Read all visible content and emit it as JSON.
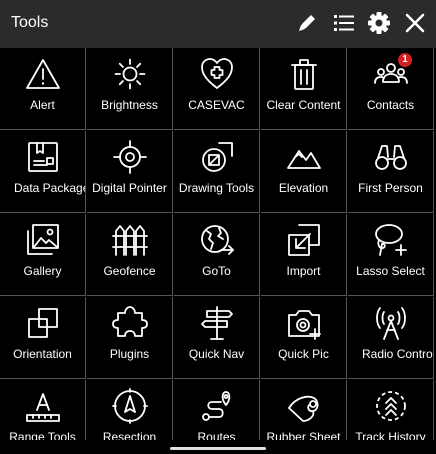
{
  "header": {
    "title": "Tools"
  },
  "header_icons": [
    "pencil-icon",
    "list-icon",
    "gear-icon",
    "close-icon"
  ],
  "accent": {
    "badge": "#d32020"
  },
  "tools": [
    {
      "label": "Alert",
      "icon": "alert-icon"
    },
    {
      "label": "Brightness",
      "icon": "brightness-icon"
    },
    {
      "label": "CASEVAC",
      "icon": "casevac-icon"
    },
    {
      "label": "Clear Content",
      "icon": "trash-icon"
    },
    {
      "label": "Contacts",
      "icon": "contacts-icon",
      "badge": "1"
    },
    {
      "label": "Data Packages",
      "icon": "data-packages-icon"
    },
    {
      "label": "Digital Pointer",
      "icon": "crosshair-icon"
    },
    {
      "label": "Drawing Tools",
      "icon": "drawing-tools-icon"
    },
    {
      "label": "Elevation",
      "icon": "mountains-icon"
    },
    {
      "label": "First Person",
      "icon": "binoculars-icon"
    },
    {
      "label": "Gallery",
      "icon": "gallery-icon"
    },
    {
      "label": "Geofence",
      "icon": "geofence-icon"
    },
    {
      "label": "GoTo",
      "icon": "globe-arrow-icon"
    },
    {
      "label": "Import",
      "icon": "import-icon"
    },
    {
      "label": "Lasso Select",
      "icon": "lasso-icon"
    },
    {
      "label": "Orientation",
      "icon": "orientation-icon"
    },
    {
      "label": "Plugins",
      "icon": "puzzle-icon"
    },
    {
      "label": "Quick Nav",
      "icon": "signpost-icon"
    },
    {
      "label": "Quick Pic",
      "icon": "camera-plus-icon"
    },
    {
      "label": "Radio Controls",
      "icon": "radio-tower-icon"
    },
    {
      "label": "Range Tools",
      "icon": "range-ruler-icon"
    },
    {
      "label": "Resection",
      "icon": "compass-icon"
    },
    {
      "label": "Routes",
      "icon": "route-icon"
    },
    {
      "label": "Rubber Sheet",
      "icon": "rubber-sheet-icon"
    },
    {
      "label": "Track History",
      "icon": "track-history-icon"
    }
  ]
}
